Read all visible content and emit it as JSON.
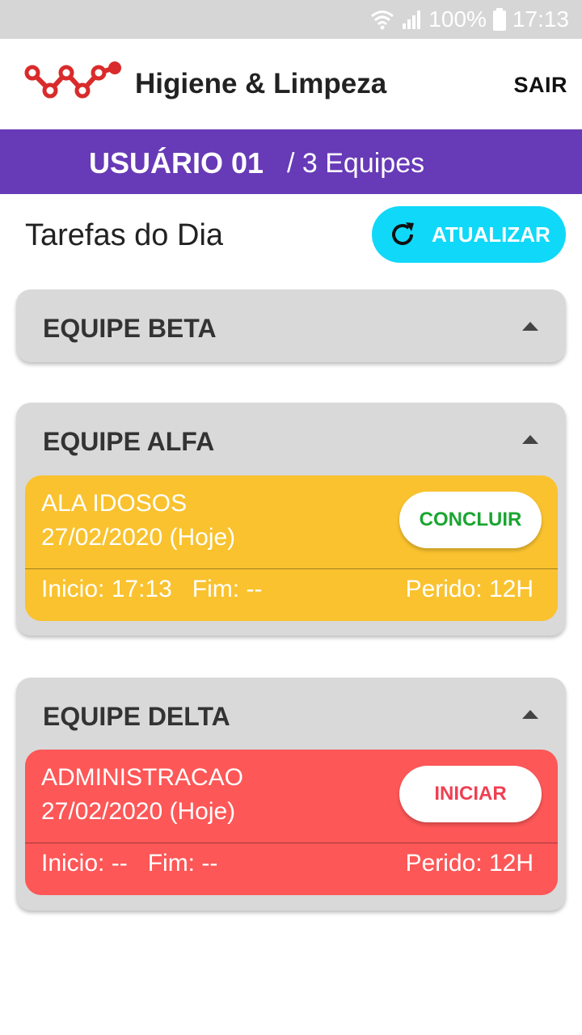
{
  "status_bar": {
    "battery": "100%",
    "time": "17:13"
  },
  "app": {
    "title": "Higiene & Limpeza",
    "logout_label": "SAIR"
  },
  "user_bar": {
    "user": "USUÁRIO 01",
    "teams": "/ 3 Equipes"
  },
  "section": {
    "title": "Tarefas do Dia",
    "refresh_label": "ATUALIZAR"
  },
  "colors": {
    "purple": "#673ab7",
    "cyan": "#10d8f8",
    "yellow": "#f9c22e",
    "red": "#fd5757",
    "green_text": "#1aa531",
    "red_text": "#ef3f52"
  },
  "teams": [
    {
      "name": "EQUIPE BETA"
    },
    {
      "name": "EQUIPE ALFA",
      "task": {
        "place": "ALA IDOSOS",
        "date": "27/02/2020 (Hoje)",
        "start": "Inicio: 17:13",
        "end": "Fim: --",
        "period": "Perido: 12H",
        "action": "CONCLUIR"
      }
    },
    {
      "name": "EQUIPE DELTA",
      "task": {
        "place": "ADMINISTRACAO",
        "date": "27/02/2020 (Hoje)",
        "start": "Inicio: --",
        "end": "Fim: --",
        "period": "Perido: 12H",
        "action": "INICIAR"
      }
    }
  ]
}
